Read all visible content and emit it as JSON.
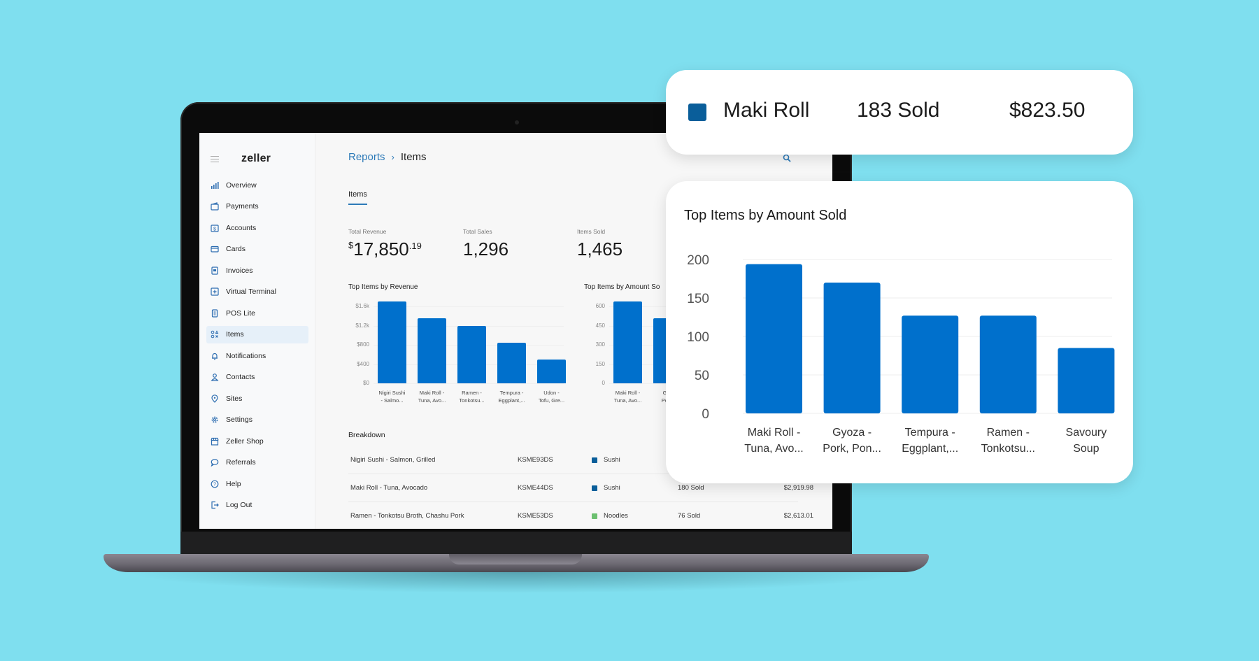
{
  "app": {
    "logo": "zeller",
    "breadcrumb": {
      "parent": "Reports",
      "separator": "›",
      "current": "Items"
    },
    "tab": "Items"
  },
  "sidebar": {
    "items": [
      {
        "label": "Overview",
        "icon": "bar-chart-icon"
      },
      {
        "label": "Payments",
        "icon": "wallet-icon"
      },
      {
        "label": "Accounts",
        "icon": "dollar-account-icon"
      },
      {
        "label": "Cards",
        "icon": "credit-card-icon"
      },
      {
        "label": "Invoices",
        "icon": "invoice-icon"
      },
      {
        "label": "Virtual Terminal",
        "icon": "plus-square-icon"
      },
      {
        "label": "POS Lite",
        "icon": "pos-device-icon"
      },
      {
        "label": "Items",
        "icon": "items-grid-icon",
        "active": true
      },
      {
        "label": "Notifications",
        "icon": "bell-icon"
      },
      {
        "label": "Contacts",
        "icon": "person-icon"
      },
      {
        "label": "Sites",
        "icon": "map-pin-icon"
      },
      {
        "label": "Settings",
        "icon": "gear-icon"
      },
      {
        "label": "Zeller Shop",
        "icon": "store-icon"
      },
      {
        "label": "Referrals",
        "icon": "chat-bubble-icon"
      },
      {
        "label": "Help",
        "icon": "help-circle-icon"
      },
      {
        "label": "Log Out",
        "icon": "log-out-icon"
      }
    ]
  },
  "stats": {
    "total_revenue": {
      "label": "Total Revenue",
      "currency": "$",
      "whole": "17,850",
      "cents": ".19"
    },
    "total_sales": {
      "label": "Total Sales",
      "value": "1,296"
    },
    "items_sold": {
      "label": "Items Sold",
      "value": "1,465"
    }
  },
  "breakdown": {
    "title": "Breakdown",
    "rows": [
      {
        "name": "Nigiri Sushi - Salmon, Grilled",
        "sku": "KSME93DS",
        "category": "Sushi",
        "category_color": "#0a5e9a",
        "sold": "",
        "amount": ""
      },
      {
        "name": "Maki Roll - Tuna, Avocado",
        "sku": "KSME44DS",
        "category": "Sushi",
        "category_color": "#0a5e9a",
        "sold": "180 Sold",
        "amount": "$2,919.98"
      },
      {
        "name": "Ramen - Tonkotsu Broth, Chashu Pork",
        "sku": "KSME53DS",
        "category": "Noodles",
        "category_color": "#6cc070",
        "sold": "76 Sold",
        "amount": "$2,613.01"
      }
    ]
  },
  "tooltip_card": {
    "swatch_color": "#0a5e9a",
    "item": "Maki Roll",
    "sold": "183 Sold",
    "amount": "$823.50"
  },
  "colors": {
    "accent": "#2d7ab8",
    "bar": "#0070cc",
    "background": "#7fdfef"
  },
  "chart_data": [
    {
      "id": "revenue",
      "type": "bar",
      "title": "Top Items by Revenue",
      "categories": [
        "Nigiri Sushi - Salmo...",
        "Maki Roll - Tuna, Avo...",
        "Ramen - Tonkotsu...",
        "Tempura - Eggplant,...",
        "Udon - Tofu, Gre..."
      ],
      "category_lines": [
        [
          "Nigiri Sushi",
          "- Salmo..."
        ],
        [
          "Maki Roll -",
          "Tuna, Avo..."
        ],
        [
          "Ramen -",
          "Tonkotsu..."
        ],
        [
          "Tempura -",
          "Eggplant,..."
        ],
        [
          "Udon -",
          "Tofu, Gre..."
        ]
      ],
      "values": [
        1700,
        1350,
        1200,
        850,
        500
      ],
      "yticks": [
        0,
        400,
        800,
        1200,
        1600
      ],
      "ytick_labels": [
        "$0",
        "$400",
        "$800",
        "$1.2k",
        "$1.6k"
      ],
      "ylim": [
        0,
        1600
      ],
      "xlabel": "",
      "ylabel": "",
      "grid": true
    },
    {
      "id": "amount-mini",
      "type": "bar",
      "title": "Top Items by Amount So",
      "categories": [
        "Maki Roll - Tuna, Avo...",
        "Gyoza - Pork,..."
      ],
      "category_lines": [
        [
          "Maki Roll -",
          "Tuna, Avo..."
        ],
        [
          "Gyo",
          "Pork,"
        ]
      ],
      "values": [
        640,
        510
      ],
      "yticks": [
        0,
        150,
        300,
        450,
        600
      ],
      "ytick_labels": [
        "0",
        "150",
        "300",
        "450",
        "600"
      ],
      "ylim": [
        0,
        600
      ],
      "xlabel": "",
      "ylabel": "",
      "grid": true
    },
    {
      "id": "amount-large",
      "type": "bar",
      "title": "Top Items by Amount Sold",
      "categories": [
        "Maki Roll - Tuna, Avo...",
        "Gyoza - Pork, Pon...",
        "Tempura - Eggplant,...",
        "Ramen - Tonkotsu...",
        "Savoury Soup"
      ],
      "category_lines": [
        [
          "Maki Roll -",
          "Tuna, Avo..."
        ],
        [
          "Gyoza -",
          "Pork, Pon..."
        ],
        [
          "Tempura -",
          "Eggplant,..."
        ],
        [
          "Ramen -",
          "Tonkotsu..."
        ],
        [
          "Savoury",
          "Soup"
        ]
      ],
      "values": [
        194,
        170,
        127,
        127,
        85
      ],
      "yticks": [
        0,
        50,
        100,
        150,
        200
      ],
      "ytick_labels": [
        "0",
        "50",
        "100",
        "150",
        "200"
      ],
      "ylim": [
        0,
        200
      ],
      "xlabel": "",
      "ylabel": "",
      "grid": true
    }
  ]
}
